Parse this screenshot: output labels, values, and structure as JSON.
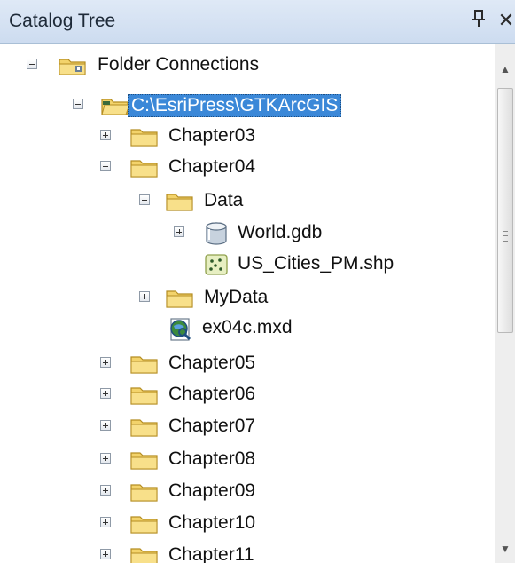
{
  "panel": {
    "title": "Catalog Tree",
    "pin_glyph": "ᵖ",
    "close_glyph": "✕"
  },
  "tree": {
    "items": [
      {
        "label": "Folder Connections",
        "icon": "folder-connections-icon",
        "expander": "collapse"
      },
      {
        "label": "C:\\EsriPress\\GTKArcGIS",
        "icon": "folder-connection-icon",
        "expander": "collapse",
        "selected": true
      },
      {
        "label": "Chapter03",
        "icon": "folder-icon",
        "expander": "expand"
      },
      {
        "label": "Chapter04",
        "icon": "folder-icon",
        "expander": "collapse"
      },
      {
        "label": "Data",
        "icon": "folder-icon",
        "expander": "collapse"
      },
      {
        "label": "World.gdb",
        "icon": "geodatabase-icon",
        "expander": "expand"
      },
      {
        "label": "US_Cities_PM.shp",
        "icon": "point-shapefile-icon",
        "expander": "none"
      },
      {
        "label": "MyData",
        "icon": "folder-icon",
        "expander": "expand"
      },
      {
        "label": "ex04c.mxd",
        "icon": "map-document-icon",
        "expander": "none"
      },
      {
        "label": "Chapter05",
        "icon": "folder-icon",
        "expander": "expand"
      },
      {
        "label": "Chapter06",
        "icon": "folder-icon",
        "expander": "expand"
      },
      {
        "label": "Chapter07",
        "icon": "folder-icon",
        "expander": "expand"
      },
      {
        "label": "Chapter08",
        "icon": "folder-icon",
        "expander": "expand"
      },
      {
        "label": "Chapter09",
        "icon": "folder-icon",
        "expander": "expand"
      },
      {
        "label": "Chapter10",
        "icon": "folder-icon",
        "expander": "expand"
      },
      {
        "label": "Chapter11",
        "icon": "folder-icon",
        "expander": "expand"
      }
    ]
  },
  "colors": {
    "selection": "#3b88d8",
    "folder": "#f3d36b",
    "titlebar": "#d7e3f3"
  }
}
